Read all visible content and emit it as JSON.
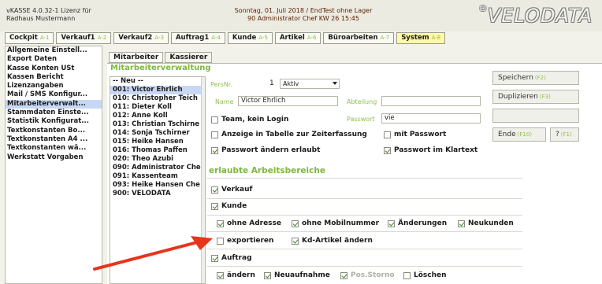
{
  "header": {
    "line1": "vKASSE 4.0.32-1 Lizenz für",
    "line2": "Radhaus Mustermann",
    "center1": "Sonntag, 01. Juli 2018 / EndTest ohne Lager",
    "center2": "90 Administrator Chef   KW 26  15:45",
    "logo": "VELODATA",
    "logo_mark": "®"
  },
  "tabs": [
    {
      "label": "Cockpit",
      "key": "A-1"
    },
    {
      "label": "Verkauf1",
      "key": "A-2"
    },
    {
      "label": "Verkauf2",
      "key": "A-3"
    },
    {
      "label": "Auftrag1",
      "key": "A-4"
    },
    {
      "label": "Kunde",
      "key": "A-5"
    },
    {
      "label": "Artikel",
      "key": "A-6"
    },
    {
      "label": "Büroarbeiten",
      "key": "A-7"
    },
    {
      "label": "System",
      "key": "A-8"
    }
  ],
  "menu": [
    "Allgemeine Einstell...",
    "Export Daten",
    "Kasse Konten USt",
    "Kassen Bericht",
    "Lizenzangaben",
    "Mail / SMS Konfigur...",
    "Mitarbeiterverwalt...",
    "Stammdaten Einste...",
    "Statistik Konfigurat...",
    "Textkonstanten Bo...",
    "Textkonstanten A4 ...",
    "Textkonstanten wä...",
    "Werkstatt Vorgaben"
  ],
  "subtabs": [
    "Mitarbeiter",
    "Kassierer"
  ],
  "panel_title": "Mitarbeiterverwaltung",
  "employees": [
    "-- Neu --",
    "001: Victor Ehrlich",
    "010: Christopher Teich",
    "011: Dieter Koll",
    "012: Anne Koll",
    "013: Christian Tschirne",
    "014: Sonja Tschirner",
    "015: Heike Hansen",
    "016: Thomas Paffen",
    "020: Theo Azubi",
    "090: Administrator Che",
    "091: Kassenteam",
    "093: Heike Hansen Che",
    "900: VELODATA"
  ],
  "form": {
    "persnr_label": "PersNr.",
    "persnr_value": "1",
    "status_value": "Aktiv",
    "name_label": "Name",
    "name_value": "Victor Ehrlich",
    "abteilung_label": "Abteilung",
    "abteilung_value": "",
    "passwort_label": "Passwort",
    "passwort_value": "vie",
    "team_label": "Team, kein Login",
    "zeiterfassung_label": "Anzeige in Tabelle zur Zeiterfassung",
    "mit_passwort_label": "mit Passwort",
    "pw_aendern_label": "Passwort ändern erlaubt",
    "pw_klartext_label": "Passwort im Klartext"
  },
  "section_title": "erlaubte Arbeitsbereiche",
  "areas": {
    "verkauf": "Verkauf",
    "kunde": "Kunde",
    "ohne_adresse": "ohne Adresse",
    "ohne_mobil": "ohne Mobilnummer",
    "aenderungen": "Änderungen",
    "neukunden": "Neukunden",
    "exportieren": "exportieren",
    "kd_artikel": "Kd-Artikel ändern",
    "auftrag": "Auftrag",
    "aendern": "ändern",
    "neuaufnahme": "Neuaufnahme",
    "pos_storno": "Pos.Storno",
    "loeschen": "Löschen"
  },
  "buttons": {
    "speichern": "Speichern",
    "speichern_key": "(F2)",
    "duplizieren": "Duplizieren",
    "duplizieren_key": "(F3)",
    "ende": "Ende",
    "ende_key": "(F10)",
    "help": "?",
    "help_key": "(F1)"
  },
  "colors": {
    "accent_green": "#7cb83e",
    "selection_blue": "#c8d8f4",
    "active_tab": "#fff9a8",
    "arrow_red": "#e8341c"
  }
}
